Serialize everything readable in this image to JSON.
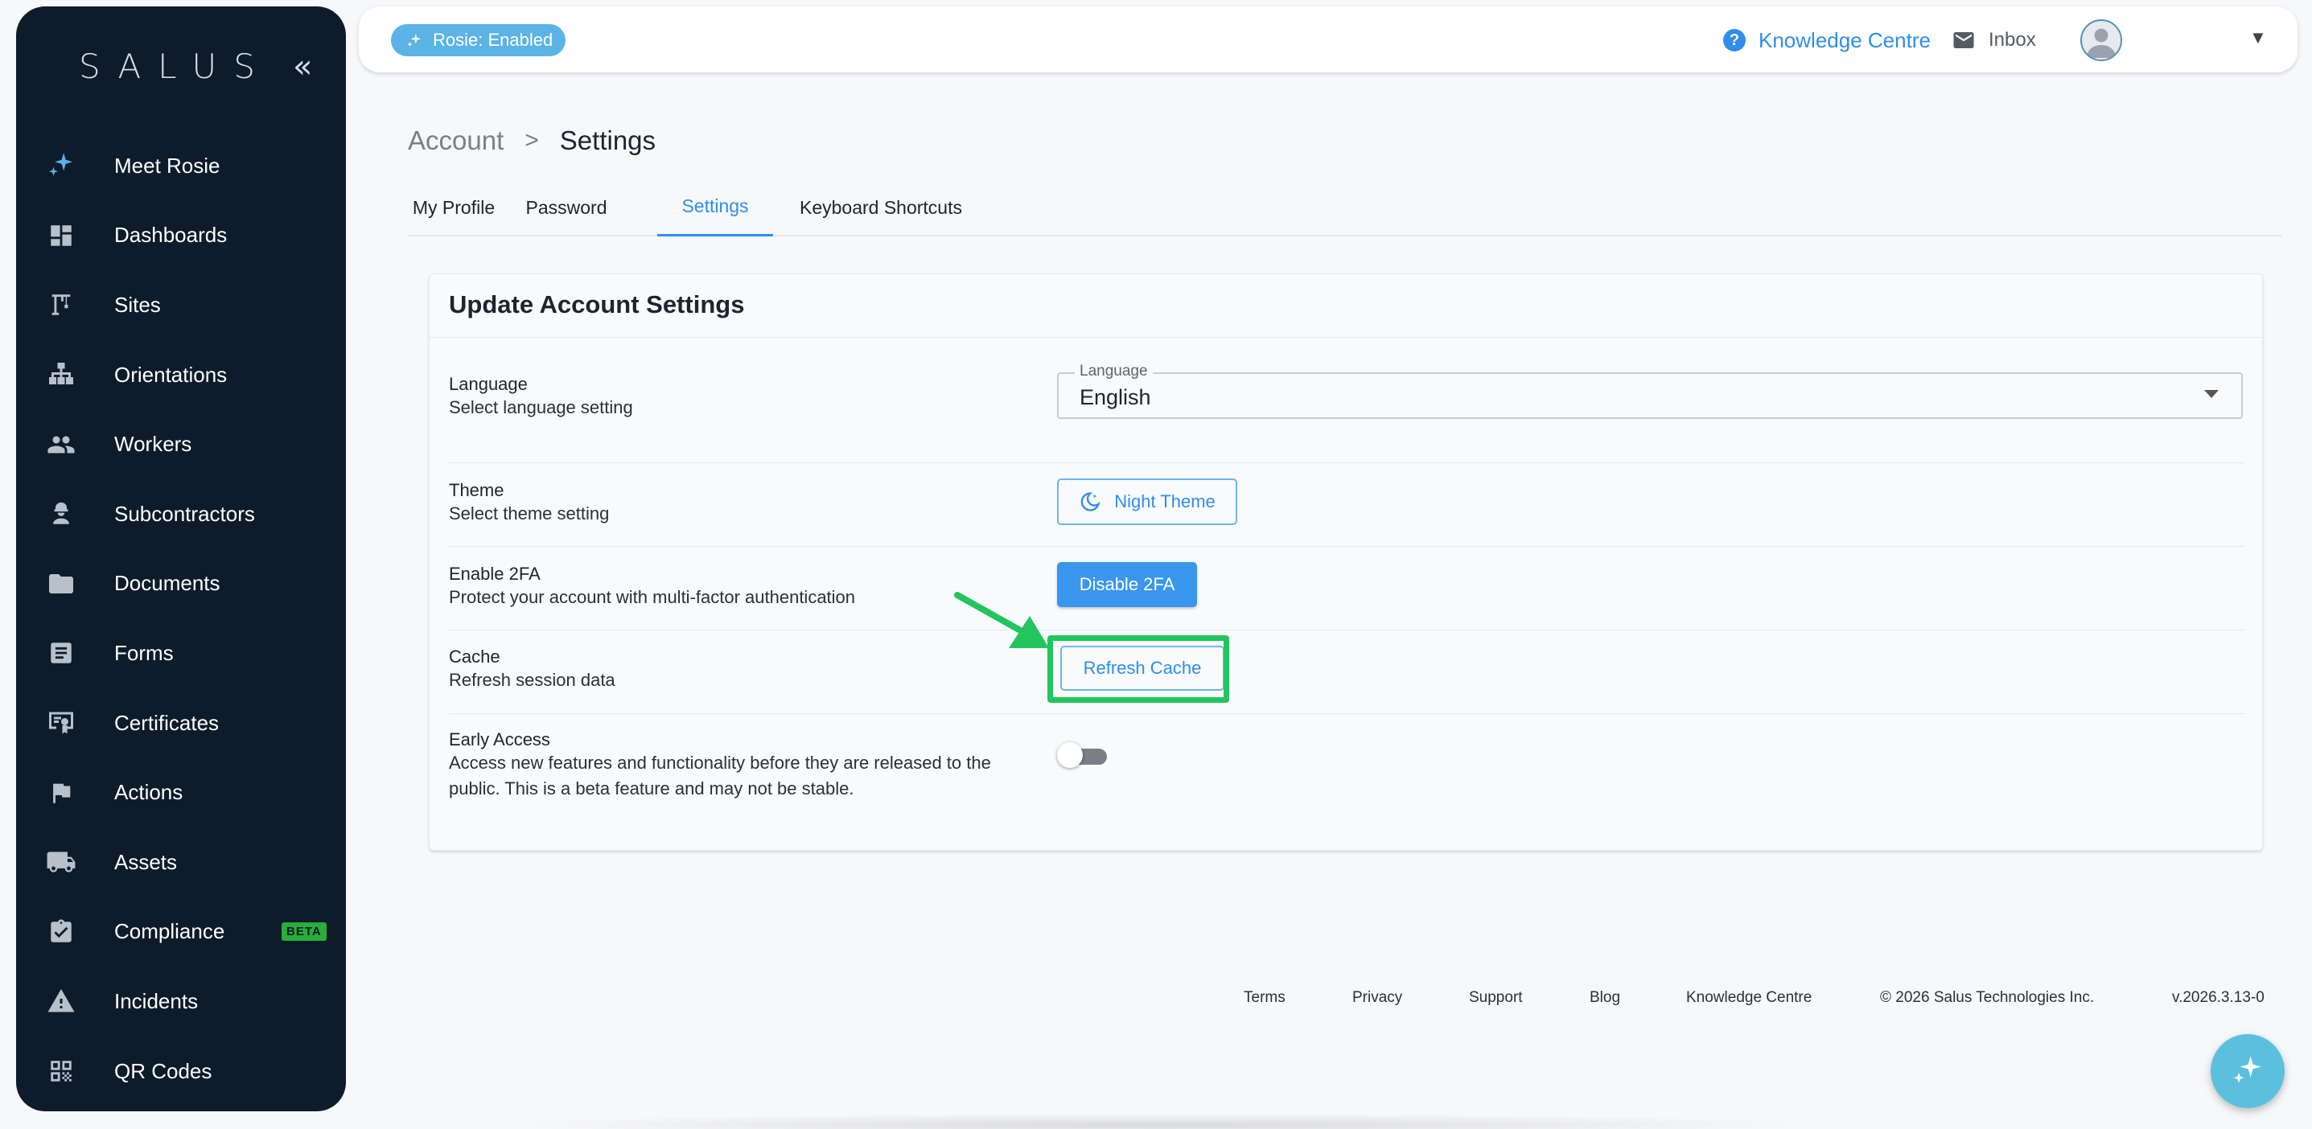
{
  "sidebar": {
    "logo": "SALUS",
    "collapse_label": "«",
    "items": [
      {
        "label": "Meet Rosie",
        "icon": "sparkle-icon"
      },
      {
        "label": "Dashboards",
        "icon": "dashboard-icon"
      },
      {
        "label": "Sites",
        "icon": "crane-icon"
      },
      {
        "label": "Orientations",
        "icon": "org-chart-icon"
      },
      {
        "label": "Workers",
        "icon": "people-icon"
      },
      {
        "label": "Subcontractors",
        "icon": "worker-helmet-icon"
      },
      {
        "label": "Documents",
        "icon": "folder-icon"
      },
      {
        "label": "Forms",
        "icon": "form-icon"
      },
      {
        "label": "Certificates",
        "icon": "certificate-icon"
      },
      {
        "label": "Actions",
        "icon": "flag-icon"
      },
      {
        "label": "Assets",
        "icon": "truck-icon"
      },
      {
        "label": "Compliance",
        "icon": "clipboard-check-icon",
        "badge": "BETA"
      },
      {
        "label": "Incidents",
        "icon": "warning-icon"
      },
      {
        "label": "QR Codes",
        "icon": "qr-code-icon"
      }
    ]
  },
  "topbar": {
    "rosie_badge": "Rosie: Enabled",
    "knowledge_centre": "Knowledge Centre",
    "inbox": "Inbox",
    "user_name": ""
  },
  "breadcrumb": {
    "root": "Account",
    "separator": ">",
    "current": "Settings"
  },
  "tabs": [
    {
      "label": "My Profile"
    },
    {
      "label": "Password"
    },
    {
      "label": "Settings",
      "active": true
    },
    {
      "label": "Keyboard Shortcuts"
    }
  ],
  "card": {
    "title": "Update Account Settings",
    "language": {
      "label": "Language",
      "desc": "Select language setting",
      "field_legend": "Language",
      "value": "English"
    },
    "theme": {
      "label": "Theme",
      "desc": "Select theme setting",
      "button": "Night Theme"
    },
    "twofa": {
      "label": "Enable 2FA",
      "desc": "Protect your account with multi-factor authentication",
      "button": "Disable 2FA"
    },
    "cache": {
      "label": "Cache",
      "desc": "Refresh session data",
      "button": "Refresh Cache"
    },
    "early_access": {
      "label": "Early Access",
      "desc": "Access new features and functionality before they are released to the public. This is a beta feature and may not be stable.",
      "enabled": false
    }
  },
  "footer": {
    "links": [
      "Terms",
      "Privacy",
      "Support",
      "Blog",
      "Knowledge Centre"
    ],
    "copyright": "© 2026 Salus Technologies Inc.",
    "version": "v.2026.3.13-0"
  },
  "colors": {
    "sidebar_bg": "#0d1b2a",
    "accent": "#2e8ee9",
    "highlight": "#22c55e",
    "beta": "#27ae3b"
  }
}
